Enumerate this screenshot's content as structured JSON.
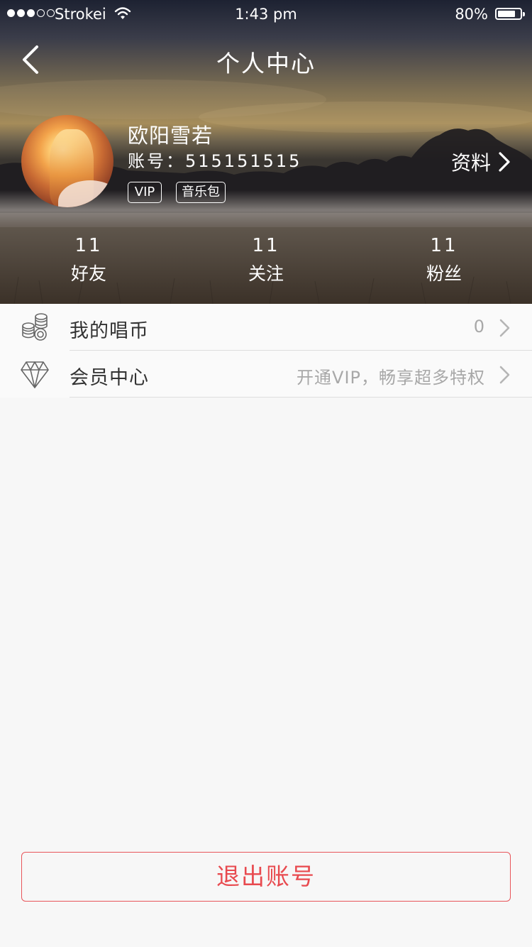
{
  "status_bar": {
    "carrier": "Strokei",
    "time": "1:43 pm",
    "battery": "80%",
    "battery_level": 0.8,
    "signal_bars_filled": 3,
    "signal_bars_total": 5
  },
  "nav": {
    "title": "个人中心",
    "back_icon": "chevron-left-icon"
  },
  "profile": {
    "name": "欧阳雪若",
    "account": "账号：515151515",
    "badges": [
      "VIP",
      "音乐包"
    ],
    "details_link": "资料"
  },
  "stats": [
    {
      "count": "11",
      "label": "好友"
    },
    {
      "count": "11",
      "label": "关注"
    },
    {
      "count": "11",
      "label": "粉丝"
    }
  ],
  "menu": [
    {
      "icon": "coins-icon",
      "title": "我的唱币",
      "value": "0"
    },
    {
      "icon": "diamond-icon",
      "title": "会员中心",
      "value": "开通VIP，畅享超多特权"
    }
  ],
  "logout_label": "退出账号",
  "colors": {
    "accent": "#e84a4f",
    "background": "#f7f7f7",
    "text_primary": "#333333",
    "text_secondary": "#a8a8a8"
  }
}
